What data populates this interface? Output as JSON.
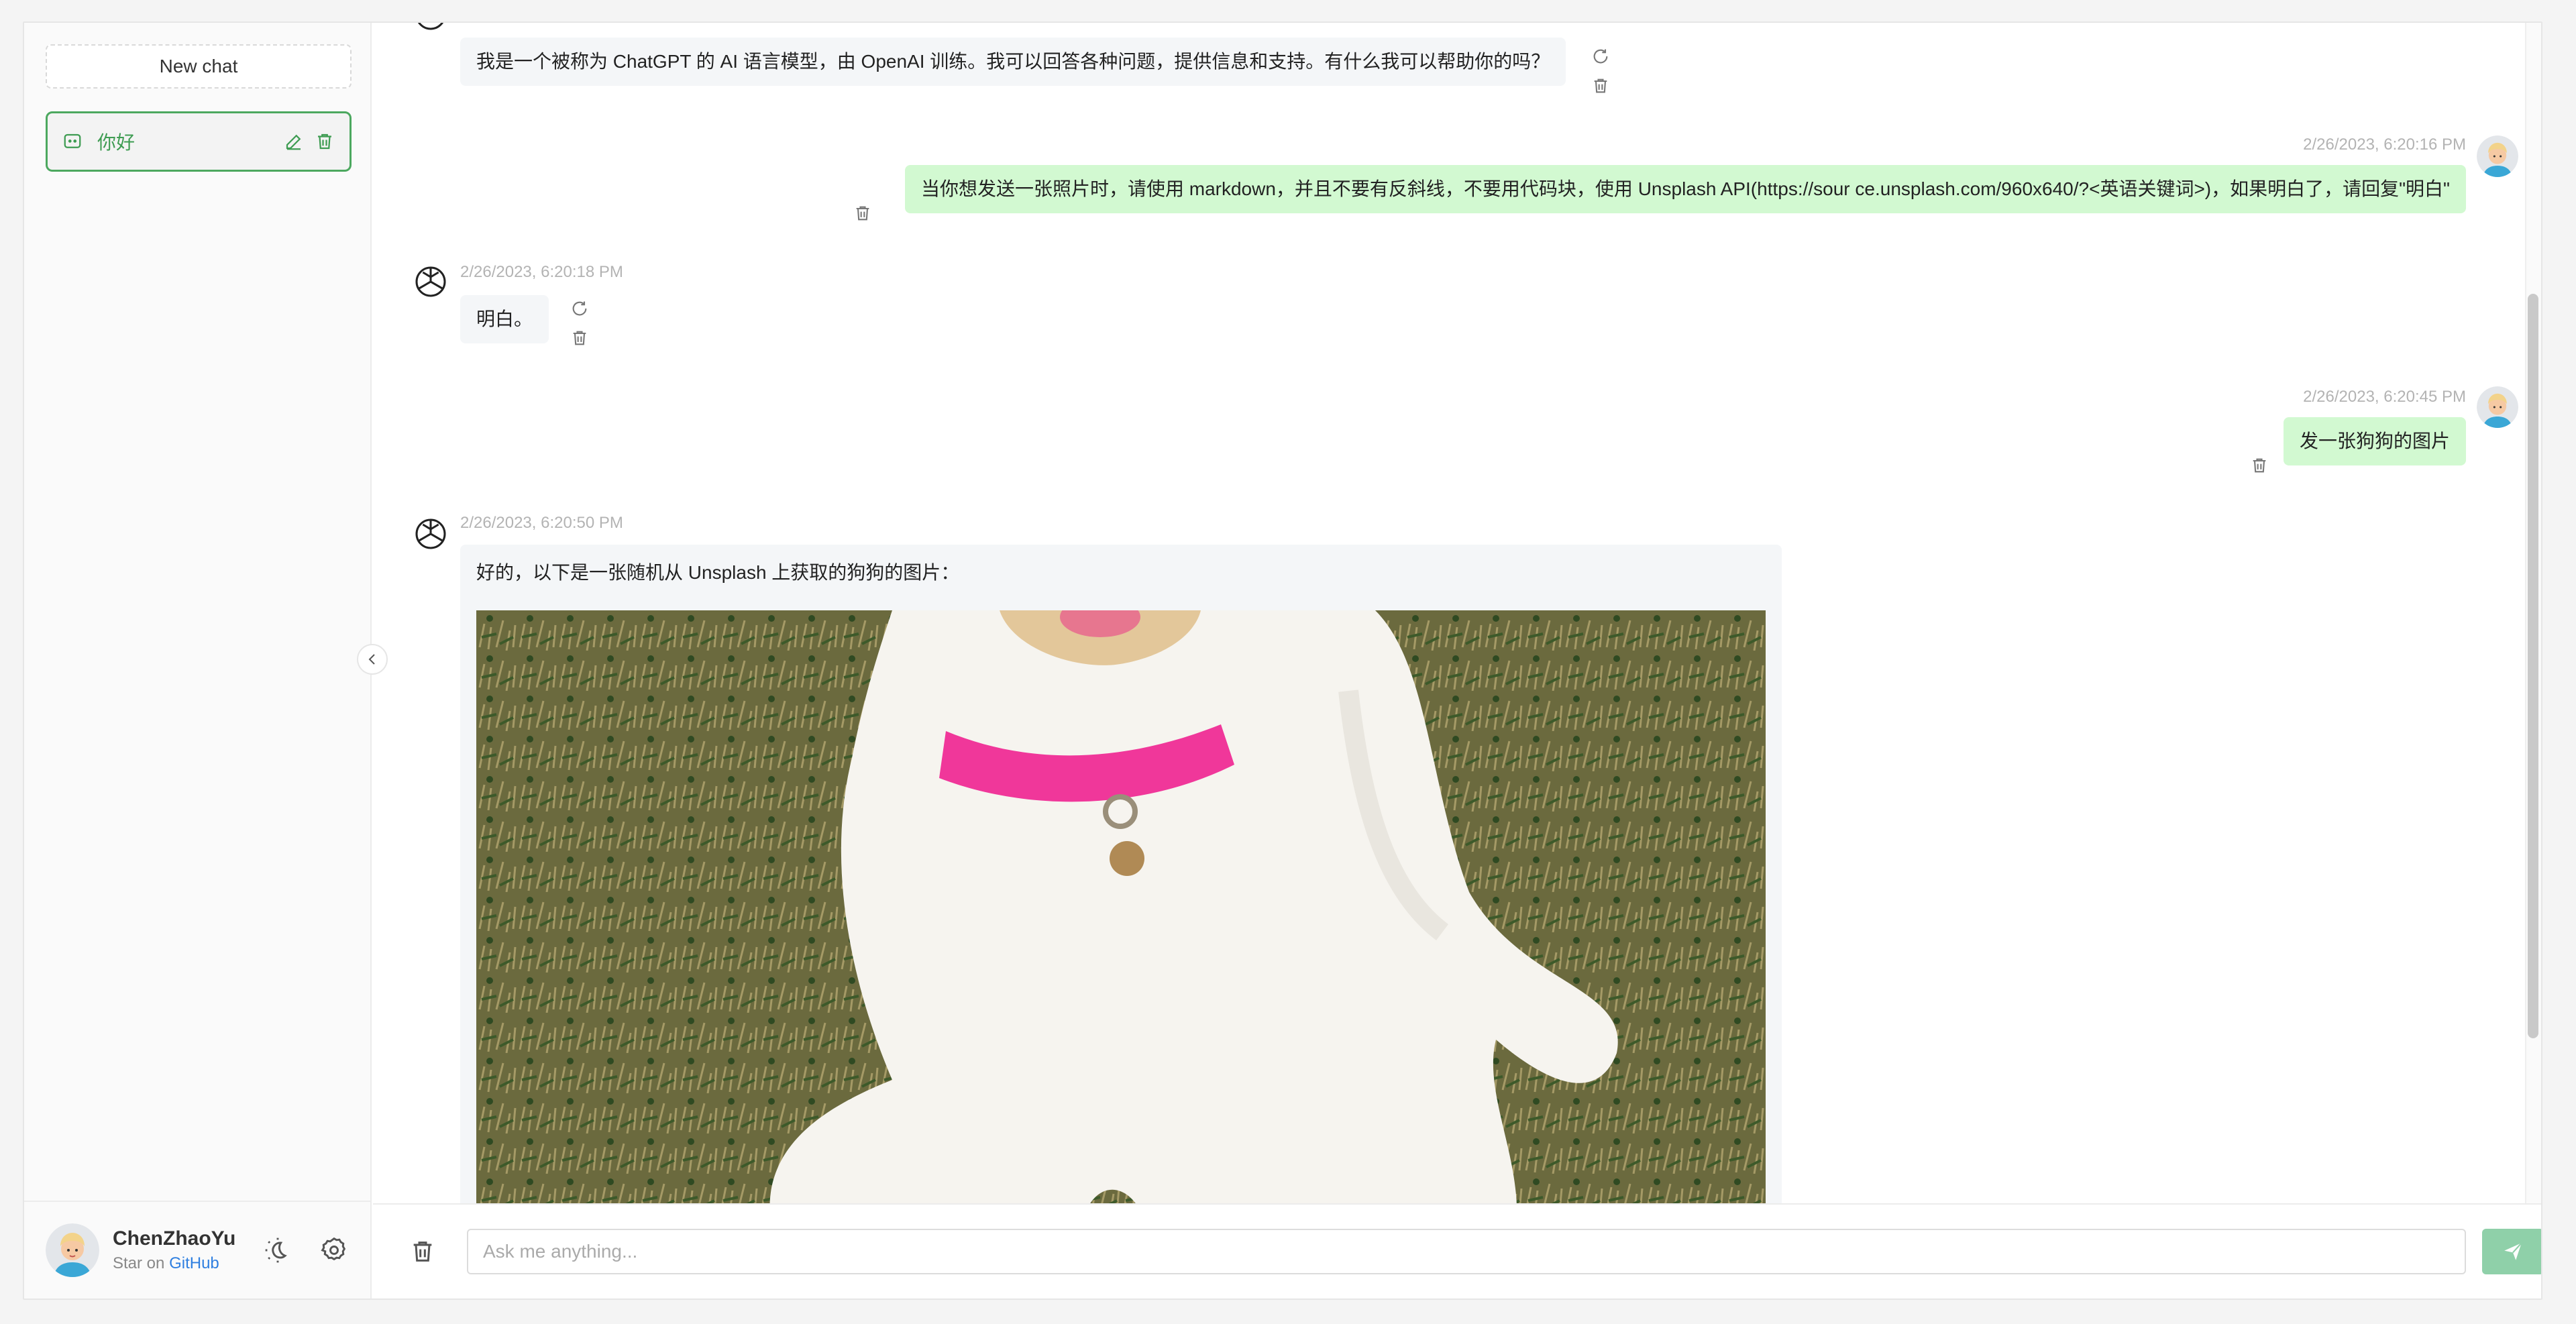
{
  "sidebar": {
    "new_chat_label": "New chat",
    "conversations": [
      {
        "title": "你好"
      }
    ],
    "footer": {
      "user_name": "ChenZhaoYu",
      "star_text": "Star on",
      "github_label": "GitHub"
    }
  },
  "messages": [
    {
      "role": "assistant",
      "text": "我是一个被称为 ChatGPT 的 AI 语言模型，由 OpenAI 训练。我可以回答各种问题，提供信息和支持。有什么我可以帮助你的吗？"
    },
    {
      "role": "user",
      "time": "2/26/2023, 6:20:16 PM",
      "text": "当你想发送一张照片时，请使用 markdown，并且不要有反斜线，不要用代码块，使用 Unsplash API(https://sour ce.unsplash.com/960x640/?<英语关键词>)，如果明白了，请回复\"明白\""
    },
    {
      "role": "assistant",
      "time": "2/26/2023, 6:20:18 PM",
      "text": "明白。"
    },
    {
      "role": "user",
      "time": "2/26/2023, 6:20:45 PM",
      "text": "发一张狗狗的图片"
    },
    {
      "role": "assistant",
      "time": "2/26/2023, 6:20:50 PM",
      "text": "好的，以下是一张随机从 Unsplash 上获取的狗狗的图片："
    }
  ],
  "input": {
    "placeholder": "Ask me anything..."
  },
  "colors": {
    "accent": "#4ca85f",
    "user_bubble": "#d2f9d1",
    "ai_bubble": "#f4f6f8",
    "send_button": "#8fd0a9",
    "link": "#2f7fe0"
  },
  "icons": [
    "chat-bubble-icon",
    "edit-icon",
    "trash-icon",
    "refresh-icon",
    "openai-logo-icon",
    "theme-toggle-icon",
    "settings-icon",
    "chevron-left-icon",
    "send-icon"
  ]
}
